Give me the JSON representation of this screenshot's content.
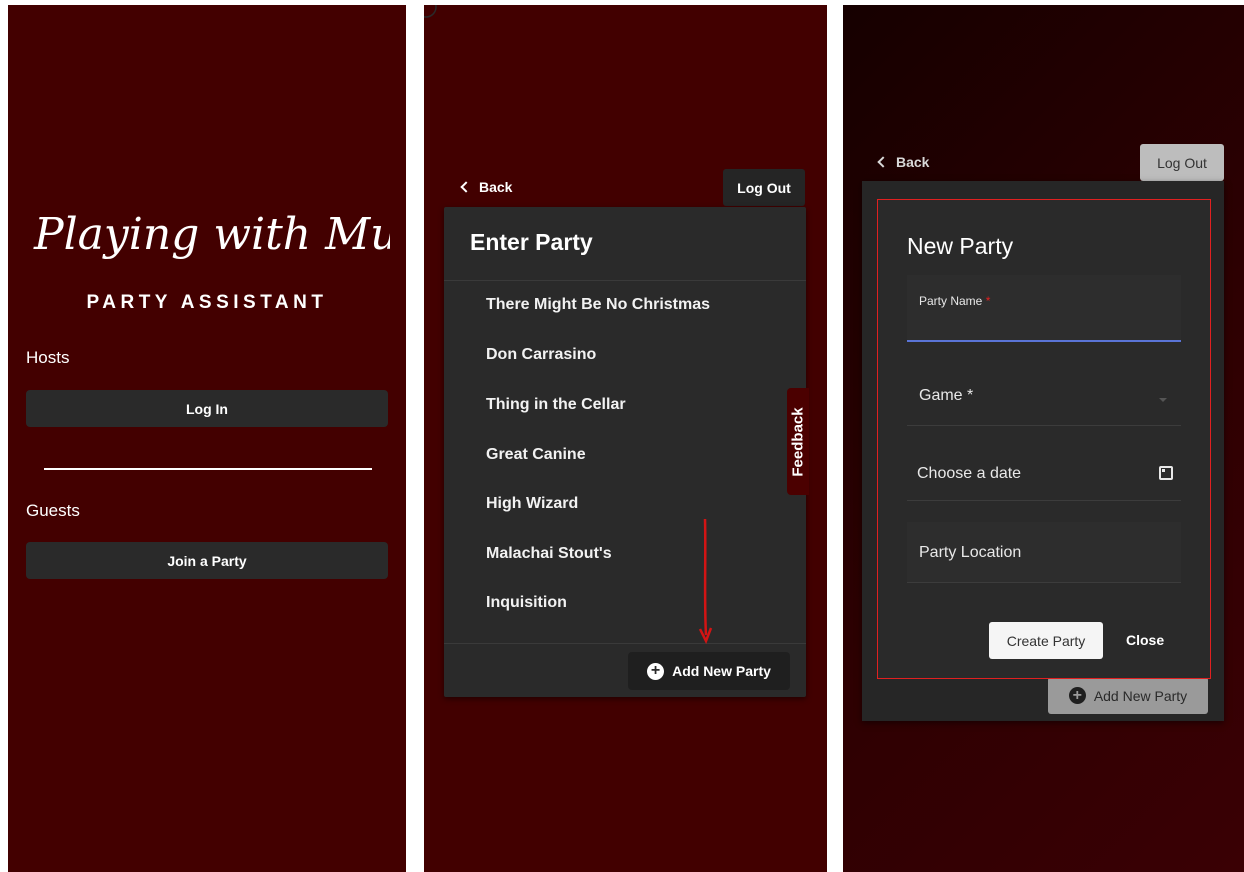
{
  "screen1": {
    "logo_text": "Playing with Murder",
    "subtitle": "PARTY ASSISTANT",
    "hosts_label": "Hosts",
    "login_button": "Log In",
    "guests_label": "Guests",
    "join_button": "Join a Party"
  },
  "screen2": {
    "back_label": "Back",
    "logout_label": "Log Out",
    "card_title": "Enter Party",
    "parties": [
      "There Might Be No Christmas",
      "Don Carrasino",
      "Thing in the Cellar",
      "Great Canine",
      "High Wizard",
      "Malachai Stout's",
      "Inquisition"
    ],
    "add_party_label": "Add New Party",
    "feedback_label": "Feedback"
  },
  "screen3": {
    "back_label": "Back",
    "logout_label": "Log Out",
    "dialog": {
      "title": "New Party",
      "party_name_label": "Party Name",
      "required_marker": "*",
      "game_label": "Game *",
      "date_label": "Choose a date",
      "location_label": "Party Location",
      "create_button": "Create Party",
      "close_button": "Close"
    },
    "add_party_label": "Add New Party"
  },
  "colors": {
    "background_maroon": "#430000",
    "card_dark": "#2a2a2a",
    "highlight_red": "#e02020",
    "focus_blue": "#5a74d6"
  },
  "icons": [
    "chevron-left-icon",
    "plus-circle-icon",
    "calendar-icon",
    "dropdown-caret-icon",
    "arrow-down-annotation"
  ]
}
